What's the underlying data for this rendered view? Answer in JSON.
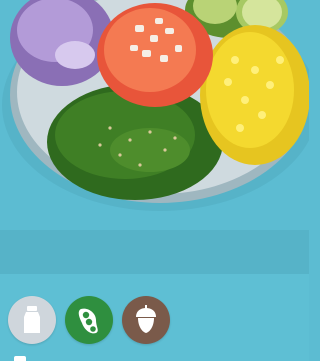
{
  "hero": {
    "image_name": "poke-bowl-image"
  },
  "badges": [
    {
      "name": "dairy-icon",
      "color": "#cfd6dc"
    },
    {
      "name": "soy-icon",
      "color": "#2f8f3f"
    },
    {
      "name": "nut-icon",
      "color": "#7a5a4a"
    }
  ]
}
